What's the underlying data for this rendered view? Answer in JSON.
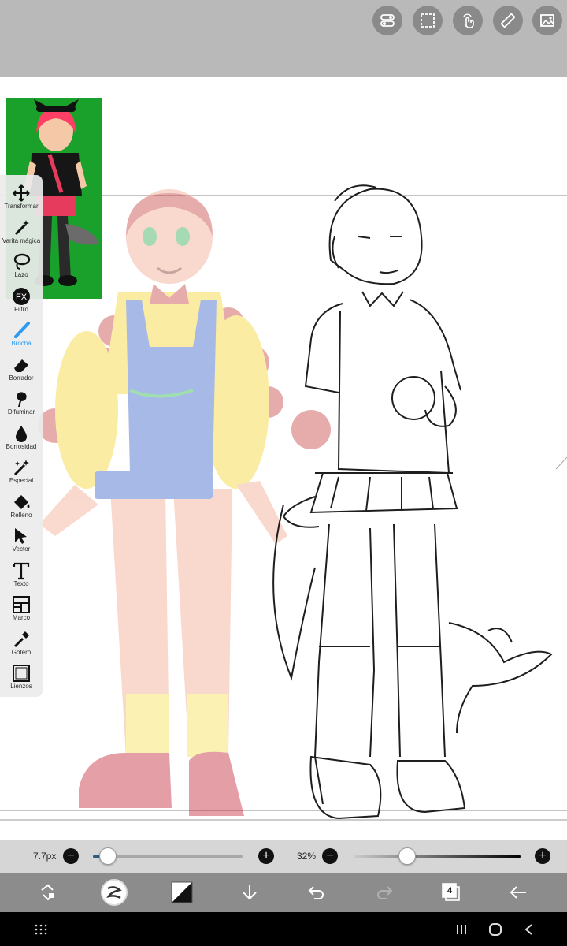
{
  "top_toolbar": {
    "icons": [
      "toggle-icon",
      "selection-icon",
      "touch-icon",
      "ruler-icon",
      "image-icon"
    ]
  },
  "tools": [
    {
      "label": "Transformar",
      "icon": "move-icon",
      "active": false
    },
    {
      "label": "Varita mágica",
      "icon": "magic-wand-icon",
      "active": false
    },
    {
      "label": "Lazo",
      "icon": "lasso-icon",
      "active": false
    },
    {
      "label": "Filtro",
      "icon": "fx-icon",
      "active": false
    },
    {
      "label": "Brocha",
      "icon": "brush-icon",
      "active": true
    },
    {
      "label": "Borrador",
      "icon": "eraser-icon",
      "active": false
    },
    {
      "label": "Difuminar",
      "icon": "smudge-icon",
      "active": false
    },
    {
      "label": "Borrosidad",
      "icon": "blur-icon",
      "active": false
    },
    {
      "label": "Especial",
      "icon": "special-icon",
      "active": false
    },
    {
      "label": "Relleno",
      "icon": "fill-icon",
      "active": false
    },
    {
      "label": "Vector",
      "icon": "vector-icon",
      "active": false
    },
    {
      "label": "Texto",
      "icon": "text-icon",
      "active": false
    },
    {
      "label": "Marco",
      "icon": "frame-icon",
      "active": false
    },
    {
      "label": "Gotero",
      "icon": "eyedropper-icon",
      "active": false
    },
    {
      "label": "Lienzos",
      "icon": "canvas-icon",
      "active": false
    }
  ],
  "sliders": {
    "brush_size": {
      "value_label": "7.7px",
      "fraction": 0.1
    },
    "opacity": {
      "value_label": "32%",
      "fraction": 0.32
    }
  },
  "bottom_toolbar": {
    "layer_count": "4",
    "icons": [
      "swap-icon",
      "brush-preview-icon",
      "color-swatch-icon",
      "download-icon",
      "undo-icon",
      "redo-icon",
      "layers-icon",
      "back-icon"
    ]
  },
  "colors": {
    "toolbar_gray": "#b9b9b9",
    "reference_green": "#1aa12b",
    "active_blue": "#2a9af3",
    "slider_blue": "#2e5c8a"
  }
}
